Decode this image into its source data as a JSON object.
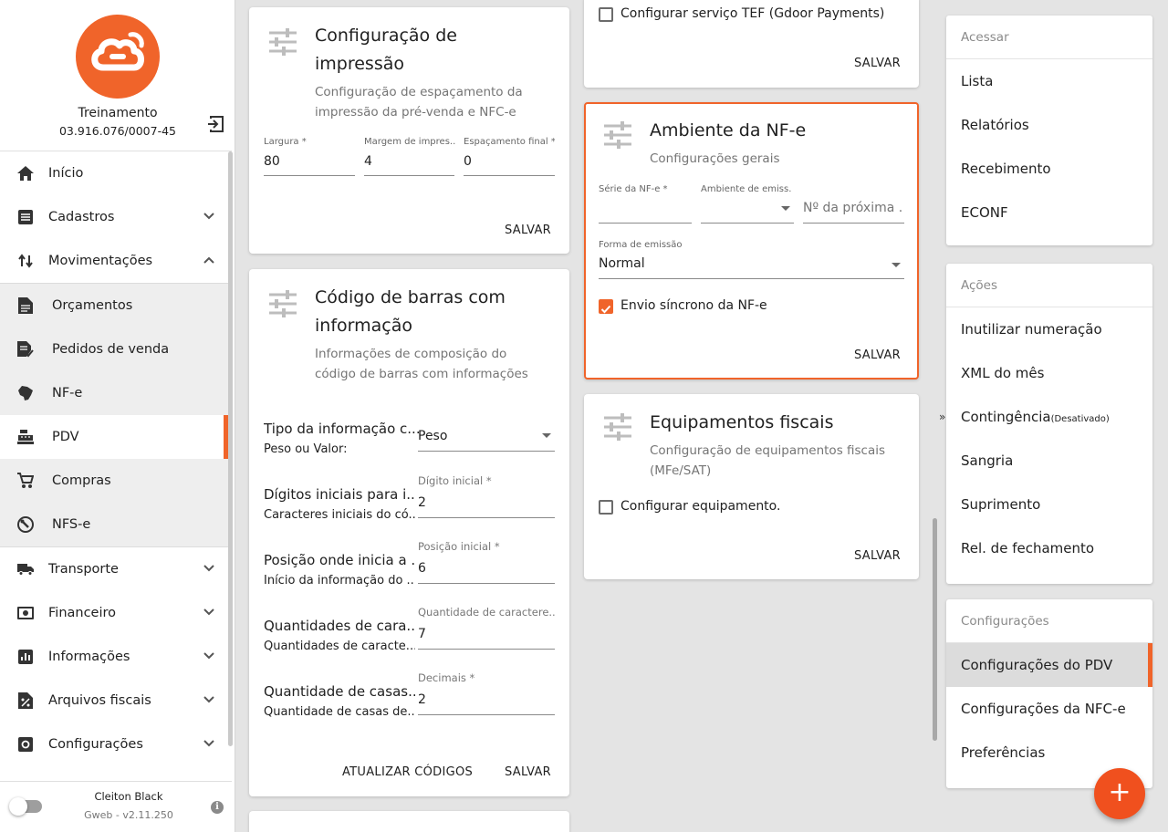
{
  "sidebar": {
    "company_name": "Treinamento",
    "company_doc": "03.916.076/0007-45",
    "menu": [
      {
        "label": "Início",
        "icon": "home-icon"
      },
      {
        "label": "Cadastros",
        "icon": "cadastros-icon"
      },
      {
        "label": "Movimentações",
        "icon": "swap-vertical-icon"
      }
    ],
    "submenu": [
      {
        "label": "Orçamentos",
        "icon": "document-icon"
      },
      {
        "label": "Pedidos de venda",
        "icon": "document-check-icon"
      },
      {
        "label": "NF-e",
        "icon": "brazil-map-icon"
      },
      {
        "label": "PDV",
        "icon": "cash-register-icon"
      },
      {
        "label": "Compras",
        "icon": "cart-icon"
      },
      {
        "label": "NFS-e",
        "icon": "wrench-clock-icon"
      }
    ],
    "menu2": [
      {
        "label": "Transporte",
        "icon": "truck-icon"
      },
      {
        "label": "Financeiro",
        "icon": "money-icon"
      },
      {
        "label": "Informações",
        "icon": "bar-chart-icon"
      },
      {
        "label": "Arquivos fiscais",
        "icon": "percent-file-icon"
      },
      {
        "label": "Configurações",
        "icon": "settings-icon"
      }
    ],
    "user_name": "Cleiton Black",
    "version": "Gweb - v2.11.250"
  },
  "card_impressao": {
    "title": "Configuração de impressão",
    "subtitle": "Configuração de espaçamento da impressão da pré-venda e NFC-e",
    "fields": [
      {
        "label": "Largura *",
        "value": "80"
      },
      {
        "label": "Margem de impres...",
        "value": "4"
      },
      {
        "label": "Espaçamento final *",
        "value": "0"
      }
    ],
    "save": "SALVAR"
  },
  "card_barras": {
    "title": "Código de barras com informação",
    "subtitle": "Informações de composição do código de barras com informações",
    "rows": [
      {
        "title": "Tipo da informação c...",
        "sub": "Peso ou Valor:",
        "label": "",
        "value": "Peso"
      },
      {
        "title": "Dígitos iniciais para i...",
        "sub": "Caracteres iniciais do có...",
        "label": "Dígito inicial *",
        "value": "2"
      },
      {
        "title": "Posição onde inicia a ...",
        "sub": "Início da informação do ...",
        "label": "Posição inicial *",
        "value": "6"
      },
      {
        "title": "Quantidades de cara...",
        "sub": "Quantidades de caracte...",
        "label": "Quantidade de caractere...",
        "value": "7"
      },
      {
        "title": "Quantidade de casas...",
        "sub": "Quantidade de casas de...",
        "label": "Decimais *",
        "value": "2"
      }
    ],
    "update": "ATUALIZAR CÓDIGOS",
    "save": "SALVAR"
  },
  "card_tef": {
    "checkbox": "Configurar serviço TEF (Gdoor Payments)",
    "save": "SALVAR"
  },
  "card_nfe": {
    "title": "Ambiente da NF-e",
    "subtitle": "Configurações gerais",
    "serie_label": "Série da NF-e *",
    "ambiente_label": "Ambiente de emiss...",
    "proxima_placeholder": "Nº da próxima ...",
    "forma_label": "Forma de emissão",
    "forma_value": "Normal",
    "checkbox": "Envio síncrono da NF-e",
    "save": "SALVAR"
  },
  "card_equip": {
    "title": "Equipamentos fiscais",
    "subtitle": "Configuração de equipamentos fiscais (MFe/SAT)",
    "checkbox": "Configurar equipamento.",
    "save": "SALVAR"
  },
  "right": {
    "acessar_head": "Acessar",
    "acessar": [
      "Lista",
      "Relatórios",
      "Recebimento",
      "ECONF"
    ],
    "acoes_head": "Ações",
    "acoes": [
      "Inutilizar numeração",
      "XML do mês",
      "Contingência",
      "Sangria",
      "Suprimento",
      "Rel. de fechamento"
    ],
    "contingencia_note": "(Desativado)",
    "config_head": "Configurações",
    "config": [
      "Configurações do PDV",
      "Configurações da NFC-e",
      "Preferências"
    ]
  },
  "fab": "+",
  "chevrons": "»",
  "colors": {
    "accent": "#f0642a",
    "fab": "#f0501e"
  }
}
